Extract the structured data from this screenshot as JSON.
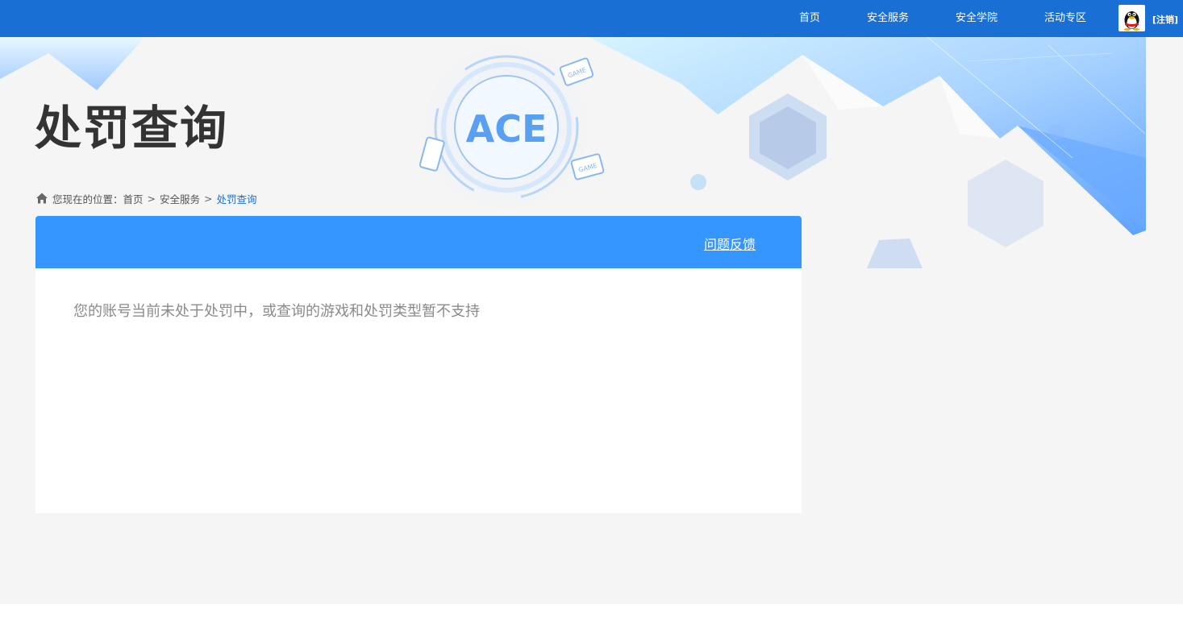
{
  "nav": {
    "items": [
      {
        "label": "首页"
      },
      {
        "label": "安全服务"
      },
      {
        "label": "安全学院"
      },
      {
        "label": "活动专区"
      }
    ],
    "logout_label": "[注销]",
    "avatar_icon": "qq-penguin-icon"
  },
  "banner": {
    "logo_text": "ACE",
    "game_badge": "GAME"
  },
  "page": {
    "title": "处罚查询"
  },
  "breadcrumb": {
    "prefix": "您现在的位置：",
    "items": [
      "首页",
      "安全服务"
    ],
    "current": "处罚查询",
    "separator": ">"
  },
  "panel": {
    "feedback_label": "问题反馈",
    "message": "您的账号当前未处于处罚中，或查询的游戏和处罚类型暂不支持"
  },
  "colors": {
    "nav_bg": "#1a6fd4",
    "panel_header": "#3696ff",
    "page_bg": "#f5f5f5"
  }
}
